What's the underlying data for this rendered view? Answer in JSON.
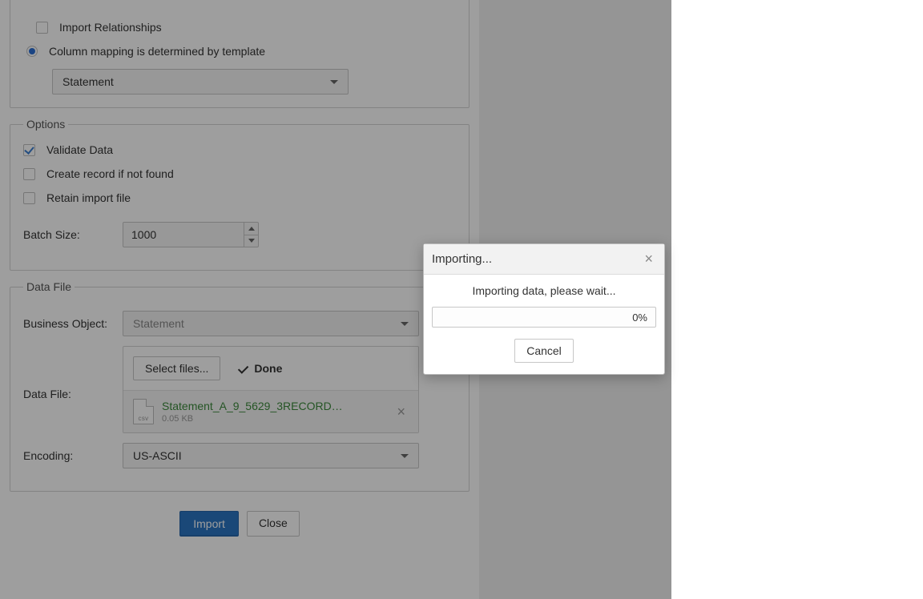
{
  "top": {
    "importRelationships": {
      "label": "Import Relationships",
      "checked": false
    },
    "columnMapping": {
      "label": "Column mapping is determined by template",
      "checked": true
    },
    "template": {
      "value": "Statement"
    }
  },
  "options": {
    "legend": "Options",
    "validateData": {
      "label": "Validate Data",
      "checked": true
    },
    "createIfNotFound": {
      "label": "Create record if not found",
      "checked": false
    },
    "retainImportFile": {
      "label": "Retain import file",
      "checked": false
    },
    "batchSize": {
      "label": "Batch Size:",
      "value": "1000"
    }
  },
  "dataFile": {
    "legend": "Data File",
    "businessObject": {
      "label": "Business Object:",
      "value": "Statement"
    },
    "dataFileLabel": "Data File:",
    "selectFilesLabel": "Select files...",
    "doneLabel": "Done",
    "file": {
      "name": "Statement_A_9_5629_3RECORD…",
      "size": "0.05 KB",
      "ext": "csv"
    },
    "encoding": {
      "label": "Encoding:",
      "value": "US-ASCII"
    }
  },
  "actions": {
    "import": "Import",
    "close": "Close"
  },
  "modal": {
    "title": "Importing...",
    "message": "Importing data, please wait...",
    "progress": "0%",
    "cancel": "Cancel"
  }
}
